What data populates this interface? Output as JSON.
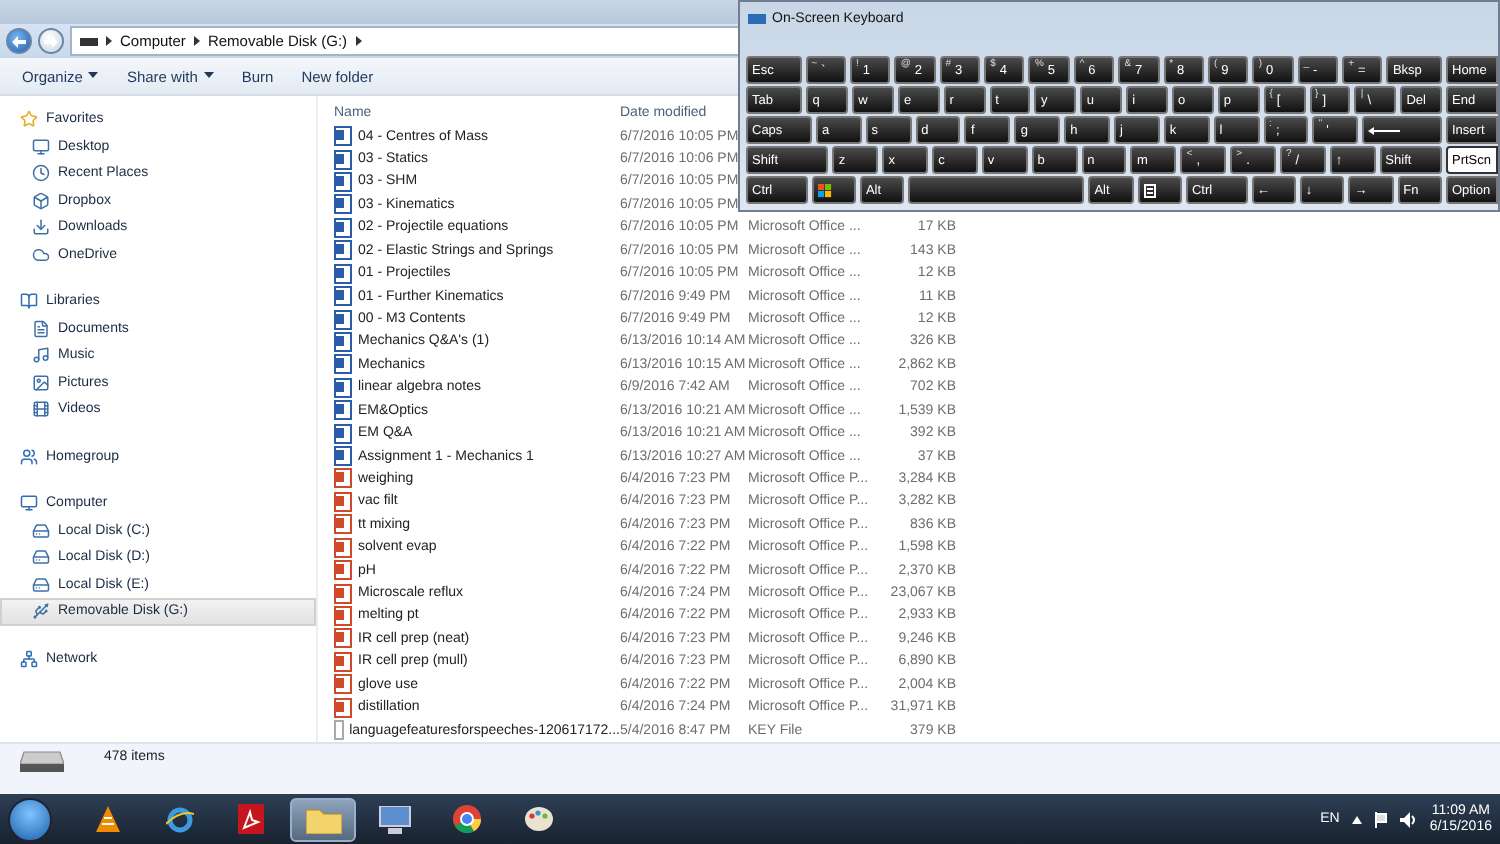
{
  "address_bar": {
    "crumbs": [
      "Computer",
      "Removable Disk (G:)"
    ]
  },
  "toolbar": [
    {
      "label": "Organize",
      "menu": true
    },
    {
      "label": "Share with",
      "menu": true
    },
    {
      "label": "Burn",
      "menu": false
    },
    {
      "label": "New folder",
      "menu": false
    }
  ],
  "sidebar": [
    {
      "label": "Favorites",
      "selected": false,
      "children": [
        {
          "label": "Desktop",
          "selected": false
        },
        {
          "label": "Recent Places",
          "selected": false
        },
        {
          "label": "Dropbox",
          "selected": false
        },
        {
          "label": "Downloads",
          "selected": false
        },
        {
          "label": "OneDrive",
          "selected": false
        }
      ]
    },
    {
      "label": "Libraries",
      "selected": false,
      "children": [
        {
          "label": "Documents",
          "selected": false
        },
        {
          "label": "Music",
          "selected": false
        },
        {
          "label": "Pictures",
          "selected": false
        },
        {
          "label": "Videos",
          "selected": false
        }
      ]
    },
    {
      "label": "Homegroup",
      "selected": false
    },
    {
      "label": "Computer",
      "selected": false,
      "children": [
        {
          "label": "Local Disk (C:)",
          "selected": false
        },
        {
          "label": "Local Disk (D:)",
          "selected": false
        },
        {
          "label": "Local Disk (E:)",
          "selected": false
        },
        {
          "label": "Removable Disk (G:)",
          "selected": true
        }
      ]
    },
    {
      "label": "Network",
      "selected": false
    }
  ],
  "table": {
    "columns": [
      "Name",
      "Date modified"
    ],
    "rows": [
      {
        "kind": "word",
        "name": "04 - Centres of Mass",
        "date": "6/7/2016 10:05 PM"
      },
      {
        "kind": "word",
        "name": "03 - Statics",
        "date": "6/7/2016 10:06 PM"
      },
      {
        "kind": "word",
        "name": "03 - SHM",
        "date": "6/7/2016 10:05 PM"
      },
      {
        "kind": "word",
        "name": "03 - Kinematics",
        "date": "6/7/2016 10:05 PM"
      },
      {
        "kind": "word",
        "name": "02 - Projectile equations",
        "date": "6/7/2016 10:05 PM",
        "type": "Microsoft Office ...",
        "size": "17 KB"
      },
      {
        "kind": "word",
        "name": "02 - Elastic Strings and Springs",
        "date": "6/7/2016 10:05 PM",
        "type": "Microsoft Office ...",
        "size": "143 KB"
      },
      {
        "kind": "word",
        "name": "01 - Projectiles",
        "date": "6/7/2016 10:05 PM",
        "type": "Microsoft Office ...",
        "size": "12 KB"
      },
      {
        "kind": "word",
        "name": "01 - Further Kinematics",
        "date": "6/7/2016 9:49 PM",
        "type": "Microsoft Office ...",
        "size": "11 KB"
      },
      {
        "kind": "word",
        "name": "00 - M3 Contents",
        "date": "6/7/2016 9:49 PM",
        "type": "Microsoft Office ...",
        "size": "12 KB"
      },
      {
        "kind": "word",
        "name": "Mechanics Q&A's (1)",
        "date": "6/13/2016 10:14 AM",
        "type": "Microsoft Office ...",
        "size": "326 KB"
      },
      {
        "kind": "word",
        "name": "Mechanics",
        "date": "6/13/2016 10:15 AM",
        "type": "Microsoft Office ...",
        "size": "2,862 KB"
      },
      {
        "kind": "word",
        "name": "linear algebra notes",
        "date": "6/9/2016 7:42 AM",
        "type": "Microsoft Office ...",
        "size": "702 KB"
      },
      {
        "kind": "word",
        "name": "EM&Optics",
        "date": "6/13/2016 10:21 AM",
        "type": "Microsoft Office ...",
        "size": "1,539 KB"
      },
      {
        "kind": "word",
        "name": "EM Q&A",
        "date": "6/13/2016 10:21 AM",
        "type": "Microsoft Office ...",
        "size": "392 KB"
      },
      {
        "kind": "word",
        "name": "Assignment 1 - Mechanics 1",
        "date": "6/13/2016 10:27 AM",
        "type": "Microsoft Office ...",
        "size": "37 KB"
      },
      {
        "kind": "slides",
        "name": "weighing",
        "date": "6/4/2016 7:23 PM",
        "type": "Microsoft Office P...",
        "size": "3,284 KB"
      },
      {
        "kind": "slides",
        "name": "vac filt",
        "date": "6/4/2016 7:23 PM",
        "type": "Microsoft Office P...",
        "size": "3,282 KB"
      },
      {
        "kind": "slides",
        "name": "tt mixing",
        "date": "6/4/2016 7:23 PM",
        "type": "Microsoft Office P...",
        "size": "836 KB"
      },
      {
        "kind": "slides",
        "name": "solvent evap",
        "date": "6/4/2016 7:22 PM",
        "type": "Microsoft Office P...",
        "size": "1,598 KB"
      },
      {
        "kind": "slides",
        "name": "pH",
        "date": "6/4/2016 7:22 PM",
        "type": "Microsoft Office P...",
        "size": "2,370 KB"
      },
      {
        "kind": "slides",
        "name": "Microscale reflux",
        "date": "6/4/2016 7:24 PM",
        "type": "Microsoft Office P...",
        "size": "23,067 KB"
      },
      {
        "kind": "slides",
        "name": "melting pt",
        "date": "6/4/2016 7:22 PM",
        "type": "Microsoft Office P...",
        "size": "2,933 KB"
      },
      {
        "kind": "slides",
        "name": "IR cell prep (neat)",
        "date": "6/4/2016 7:23 PM",
        "type": "Microsoft Office P...",
        "size": "9,246 KB"
      },
      {
        "kind": "slides",
        "name": "IR cell prep (mull)",
        "date": "6/4/2016 7:23 PM",
        "type": "Microsoft Office P...",
        "size": "6,890 KB"
      },
      {
        "kind": "slides",
        "name": "glove use",
        "date": "6/4/2016 7:22 PM",
        "type": "Microsoft Office P...",
        "size": "2,004 KB"
      },
      {
        "kind": "slides",
        "name": "distillation",
        "date": "6/4/2016 7:24 PM",
        "type": "Microsoft Office P...",
        "size": "31,971 KB"
      },
      {
        "kind": "file",
        "name": "languagefeaturesforspeeches-120617172...",
        "date": "5/4/2016 8:47 PM",
        "type": "KEY File",
        "size": "379 KB"
      }
    ]
  },
  "status_bar": {
    "count": "478 items"
  },
  "keyboard": {
    "title": "On-Screen Keyboard",
    "rows": [
      {
        "keys": [
          {
            "kind": "mod",
            "label": "Esc"
          },
          {
            "kind": "char",
            "sub": "~",
            "label": "`"
          },
          {
            "kind": "char",
            "sub": "!",
            "label": "1"
          },
          {
            "kind": "char",
            "sub": "@",
            "label": "2"
          },
          {
            "kind": "char",
            "sub": "#",
            "label": "3"
          },
          {
            "kind": "char",
            "sub": "$",
            "label": "4"
          },
          {
            "kind": "char",
            "sub": "%",
            "label": "5"
          },
          {
            "kind": "char",
            "sub": "^",
            "label": "6"
          },
          {
            "kind": "char",
            "sub": "&",
            "label": "7"
          },
          {
            "kind": "char",
            "sub": "*",
            "label": "8"
          },
          {
            "kind": "char",
            "sub": "(",
            "label": "9"
          },
          {
            "kind": "char",
            "sub": ")",
            "label": "0"
          },
          {
            "kind": "char",
            "sub": "_",
            "label": "-"
          },
          {
            "kind": "char",
            "sub": "+",
            "label": "="
          },
          {
            "kind": "mod",
            "label": "Bksp"
          }
        ]
      },
      {
        "keys": [
          {
            "kind": "mod",
            "label": "Tab"
          },
          {
            "kind": "char",
            "label": "q"
          },
          {
            "kind": "char",
            "label": "w"
          },
          {
            "kind": "char",
            "label": "e"
          },
          {
            "kind": "char",
            "label": "r"
          },
          {
            "kind": "char",
            "label": "t"
          },
          {
            "kind": "char",
            "label": "y"
          },
          {
            "kind": "char",
            "label": "u"
          },
          {
            "kind": "char",
            "label": "i"
          },
          {
            "kind": "char",
            "label": "o"
          },
          {
            "kind": "char",
            "label": "p"
          },
          {
            "kind": "char",
            "sub": "{",
            "label": "["
          },
          {
            "kind": "char",
            "sub": "}",
            "label": "]"
          },
          {
            "kind": "char",
            "sub": "|",
            "label": "\\"
          },
          {
            "kind": "char",
            "label": "Del"
          }
        ]
      },
      {
        "keys": [
          {
            "kind": "wide",
            "label": "Caps"
          },
          {
            "kind": "char",
            "label": "a"
          },
          {
            "kind": "char",
            "label": "s"
          },
          {
            "kind": "char",
            "label": "d"
          },
          {
            "kind": "char",
            "label": "f"
          },
          {
            "kind": "char",
            "label": "g"
          },
          {
            "kind": "char",
            "label": "h"
          },
          {
            "kind": "char",
            "label": "j"
          },
          {
            "kind": "char",
            "label": "k"
          },
          {
            "kind": "char",
            "label": "l"
          },
          {
            "kind": "char",
            "sub": ":",
            "label": ";"
          },
          {
            "kind": "char",
            "sub": "\"",
            "label": "'"
          },
          {
            "kind": "enter"
          }
        ]
      },
      {
        "keys": [
          {
            "kind": "wider",
            "label": "Shift"
          },
          {
            "kind": "char",
            "label": "z"
          },
          {
            "kind": "char",
            "label": "x"
          },
          {
            "kind": "char",
            "label": "c"
          },
          {
            "kind": "char",
            "label": "v"
          },
          {
            "kind": "char",
            "label": "b"
          },
          {
            "kind": "char",
            "label": "n"
          },
          {
            "kind": "char",
            "label": "m"
          },
          {
            "kind": "char",
            "sub": "<",
            "label": ","
          },
          {
            "kind": "char",
            "sub": ">",
            "label": "."
          },
          {
            "kind": "char",
            "sub": "?",
            "label": "/"
          },
          {
            "kind": "char",
            "label": "↑"
          },
          {
            "kind": "mod",
            "label": "Shift"
          }
        ]
      },
      {
        "keys": [
          {
            "kind": "mod",
            "label": "Ctrl"
          },
          {
            "kind": "windows"
          },
          {
            "kind": "char",
            "label": "Alt"
          },
          {
            "kind": "space"
          },
          {
            "kind": "char",
            "label": "Alt"
          },
          {
            "kind": "menu"
          },
          {
            "kind": "mod",
            "label": "Ctrl"
          },
          {
            "kind": "char",
            "label": "←"
          },
          {
            "kind": "char",
            "label": "↓"
          },
          {
            "kind": "char",
            "label": "→"
          },
          {
            "kind": "char",
            "label": "Fn"
          }
        ]
      }
    ],
    "side_keys": [
      {
        "label": "Home",
        "on": false
      },
      {
        "label": "End",
        "on": false
      },
      {
        "label": "Insert",
        "on": false
      },
      {
        "label": "PrtScn",
        "on": true
      },
      {
        "label": "Option",
        "on": false
      }
    ]
  },
  "taskbar": {
    "apps": [
      {
        "selected": false
      },
      {
        "selected": false
      },
      {
        "selected": false
      },
      {
        "selected": true
      },
      {
        "selected": false
      },
      {
        "selected": false
      },
      {
        "selected": false
      }
    ],
    "language": "EN",
    "time": "11:09 AM",
    "date": "6/15/2016"
  }
}
